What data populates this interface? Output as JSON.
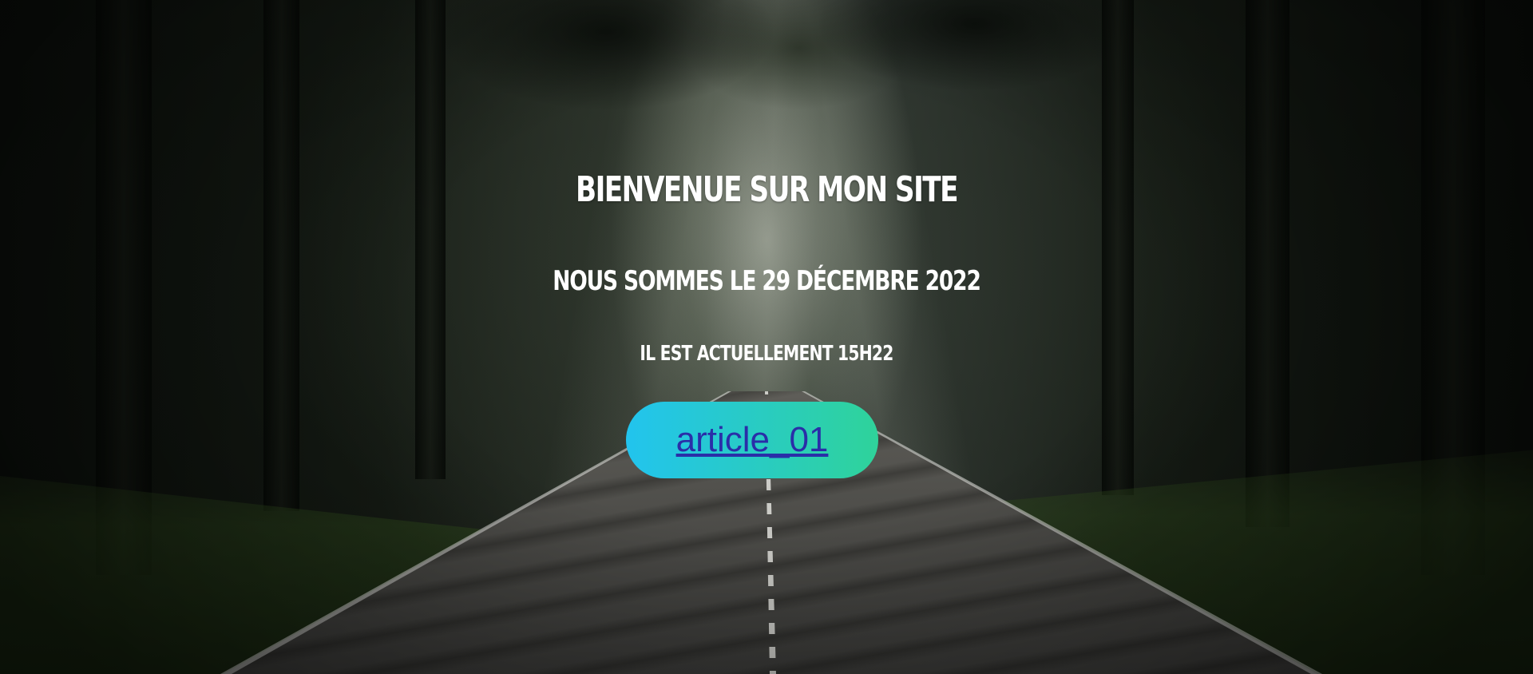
{
  "hero": {
    "title": "Bienvenue sur mon site",
    "date_text": "Nous sommes le 29 décembre 2022",
    "time_text": "Il est actuellement 15h22",
    "article_link_label": "article_01",
    "background_image": "forest-road-photo"
  },
  "colors": {
    "text": "#ffffff",
    "button_gradient_start": "#22c4ee",
    "button_gradient_end": "#2fd39a",
    "link_text": "#2a2ea8"
  }
}
